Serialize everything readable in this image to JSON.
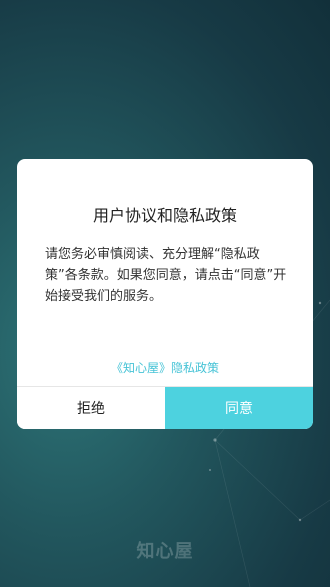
{
  "dialog": {
    "title": "用户协议和隐私政策",
    "body": "请您务必审慎阅读、充分理解“隐私政策”各条款。如果您同意，请点击“同意”开始接受我们的服务。",
    "policy_link": "《知心屋》隐私政策",
    "reject_label": "拒绝",
    "agree_label": "同意"
  },
  "background": {
    "brand_text": "知心屋"
  },
  "colors": {
    "accent": "#4dd2df",
    "link": "#46c3d6",
    "background_dark": "#173a45"
  }
}
